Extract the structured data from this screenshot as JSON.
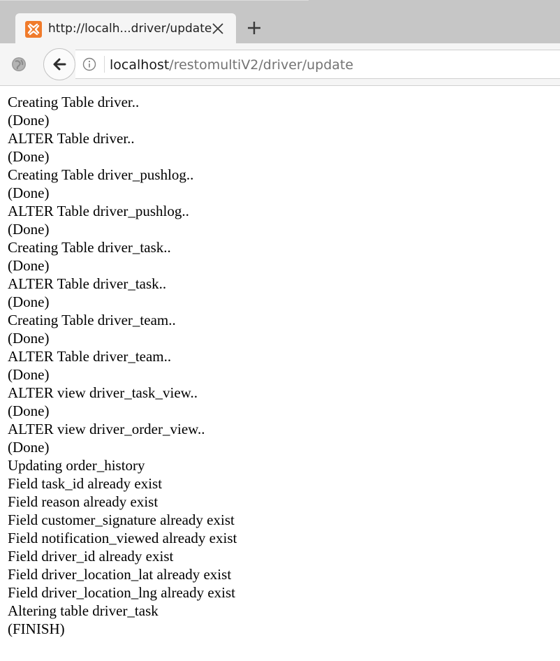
{
  "browser": {
    "tab": {
      "title": "http://localh...driver/update",
      "favicon": "xampp-logo-icon"
    },
    "url": {
      "host": "localhost",
      "path": "/restomultiV2/driver/update"
    },
    "colors": {
      "favicon": "#f07b2b",
      "tabstrip": "#c6c6c6",
      "toolbar": "#f5f5f5"
    }
  },
  "page": {
    "lines": [
      "Creating Table driver..",
      "(Done)",
      "ALTER Table driver..",
      "(Done)",
      "Creating Table driver_pushlog..",
      "(Done)",
      "ALTER Table driver_pushlog..",
      "(Done)",
      "Creating Table driver_task..",
      "(Done)",
      "ALTER Table driver_task..",
      "(Done)",
      "Creating Table driver_team..",
      "(Done)",
      "ALTER Table driver_team..",
      "(Done)",
      "ALTER view driver_task_view..",
      "(Done)",
      "ALTER view driver_order_view..",
      "(Done)",
      "Updating order_history",
      "Field task_id already exist",
      "Field reason already exist",
      "Field customer_signature already exist",
      "Field notification_viewed already exist",
      "Field driver_id already exist",
      "Field driver_location_lat already exist",
      "Field driver_location_lng already exist",
      "Altering table driver_task",
      "(FINISH)"
    ]
  }
}
